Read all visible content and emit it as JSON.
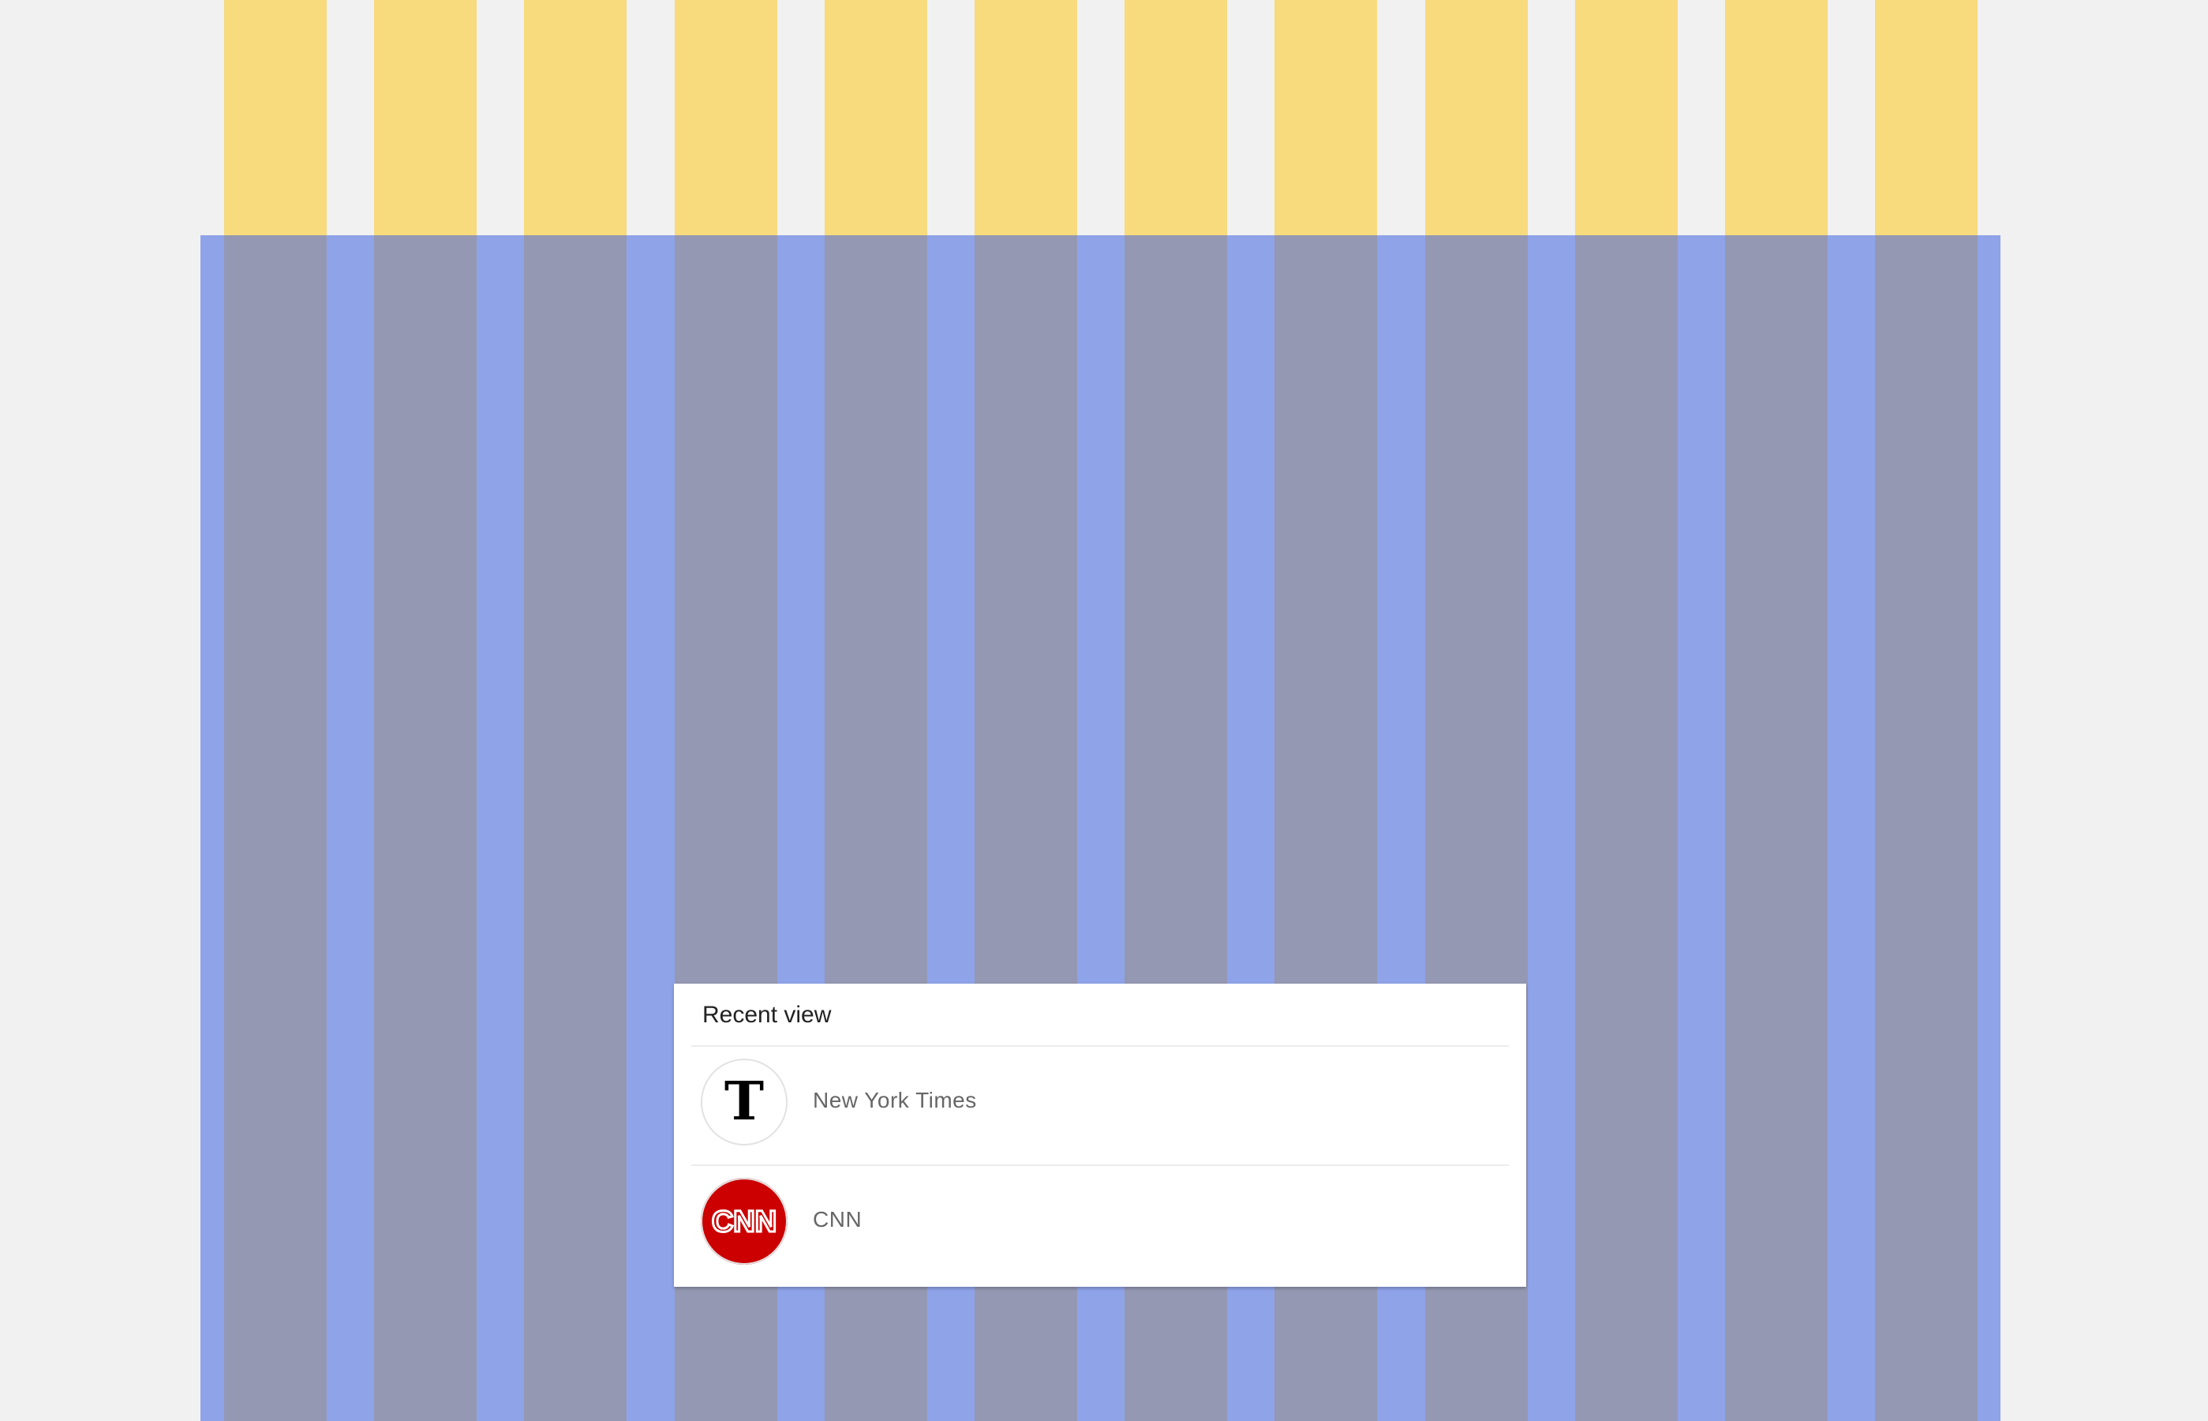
{
  "colors": {
    "background": "#f1f1f1",
    "column_top": "#f7db7d",
    "column_bottom": "#9498b2",
    "gutter": "#8fa3e9",
    "card": "#ffffff"
  },
  "recent_view": {
    "title": "Recent view",
    "items": [
      {
        "label": "New York Times",
        "logo": "nyt-logo-icon",
        "logo_text": "T"
      },
      {
        "label": "CNN",
        "logo": "cnn-logo-icon",
        "logo_text": "CNN"
      }
    ]
  }
}
